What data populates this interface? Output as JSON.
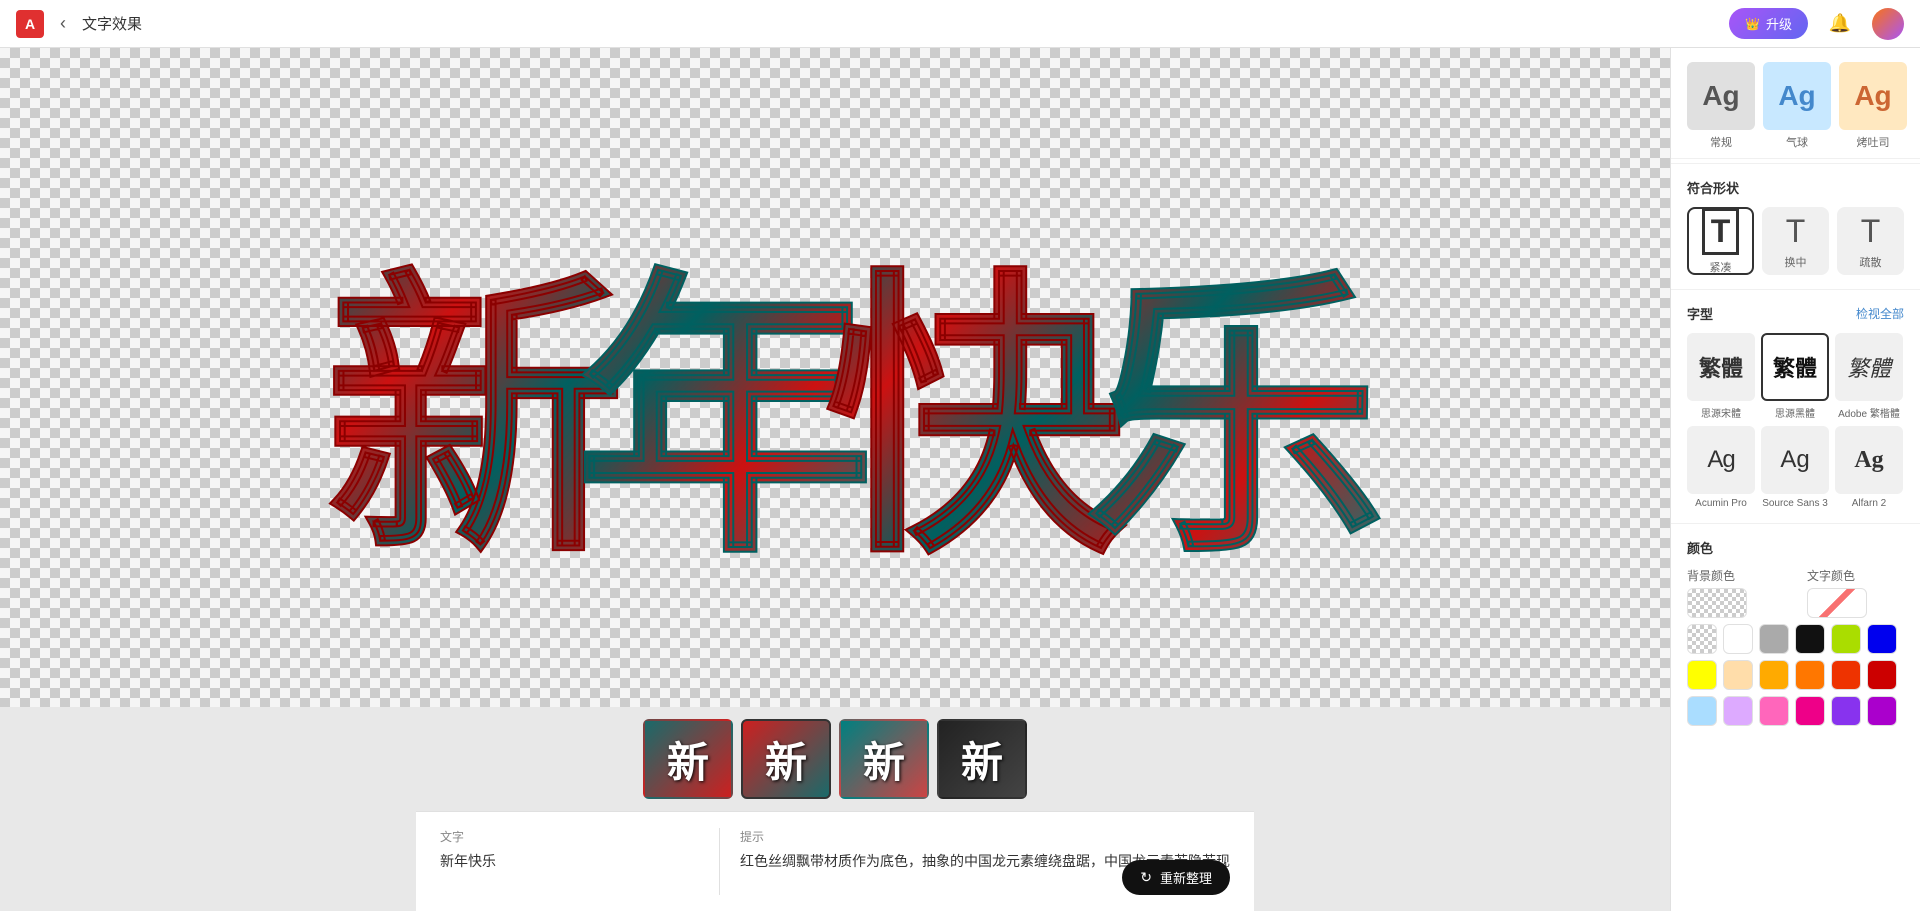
{
  "topbar": {
    "logo": "A",
    "back_label": "‹",
    "title": "文字效果",
    "upgrade_label": "升级",
    "notification_icon": "🔔",
    "avatar_icon": "avatar"
  },
  "canvas": {
    "main_text": "新年快乐"
  },
  "thumbnails": [
    {
      "char": "新",
      "style": "style1"
    },
    {
      "char": "新",
      "style": "style2",
      "active": true
    },
    {
      "char": "新",
      "style": "style3"
    },
    {
      "char": "新",
      "style": "style4"
    }
  ],
  "bottom_panel": {
    "text_label": "文字",
    "text_value": "新年快乐",
    "hint_label": "提示",
    "hint_value": "红色丝绸飘带材质作为底色，抽象的中国龙元素缠绕盘踞，中国龙元素若隐若现",
    "regenerate_label": "重新整理"
  },
  "sidebar": {
    "top_effects": [
      {
        "label": "常规",
        "text": "Ag"
      },
      {
        "label": "气球",
        "text": "Ag"
      },
      {
        "label": "烤吐司",
        "text": "Ag"
      }
    ],
    "shape_section_title": "符合形状",
    "shapes": [
      {
        "label": "紧凑",
        "symbol": "T",
        "active": true
      },
      {
        "label": "换中",
        "symbol": "T"
      },
      {
        "label": "疏散",
        "symbol": "T"
      }
    ],
    "font_section_title": "字型",
    "view_all_label": "检视全部",
    "fonts": [
      {
        "name": "思源宋體",
        "text": "繁體",
        "selected": false,
        "style": "serif"
      },
      {
        "name": "思源黑體",
        "text": "繁體",
        "selected": true,
        "style": "sans-serif-bold"
      },
      {
        "name": "Adobe 繁楷體",
        "text": "繁體",
        "selected": false,
        "style": "kai"
      },
      {
        "name": "Acumin Pro",
        "text": "Ag",
        "selected": false
      },
      {
        "name": "Source Sans 3",
        "text": "Ag",
        "selected": false
      },
      {
        "name": "Alfarn 2",
        "text": "Ag",
        "selected": false
      }
    ],
    "color_section_title": "颜色",
    "bg_color_label": "背景颜色",
    "text_color_label": "文字颜色",
    "colors_row1": [
      "transparent",
      "diagonal",
      "#ffffff",
      "#aaaaaa",
      "#111111",
      "#aadd00",
      "#0000ee"
    ],
    "colors_row2": [
      "#ffff00",
      "#ffddaa",
      "#ffaa00",
      "#ff7700",
      "#ee3300",
      "#cc0000"
    ],
    "colors_row3": [
      "#aaddff",
      "#ddaaff",
      "#ff66bb",
      "#ee0088",
      "#8833ee",
      "#aa00cc"
    ]
  }
}
